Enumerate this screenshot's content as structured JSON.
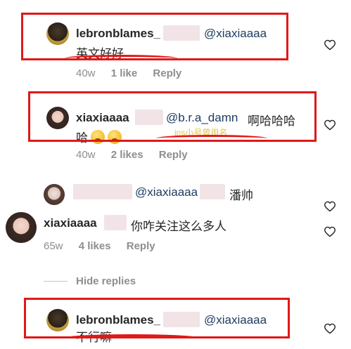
{
  "comments": [
    {
      "user": "lebronblames_",
      "mention": "@xiaxiaaaa",
      "text": "英文好好",
      "time": "40w",
      "likes": "1 like",
      "reply": "Reply"
    },
    {
      "user": "xiaxiaaaa",
      "mention": "@b.r.a_damn",
      "text_line1": "啊哈哈哈",
      "text_line2": "哈",
      "note": "ins小号曾用名",
      "time": "40w",
      "likes": "2 likes",
      "reply": "Reply"
    },
    {
      "mention": "@xiaxiaaaa",
      "text": "潘帅"
    },
    {
      "user": "xiaxiaaaa",
      "text": "你咋关注这么多人",
      "time": "65w",
      "likes": "4 likes",
      "reply": "Reply"
    },
    {
      "user": "lebronblames_",
      "mention": "@xiaxiaaaa",
      "text": "不行嘛"
    }
  ],
  "hide_replies": "Hide replies",
  "colors": {
    "highlight": "#e01818",
    "mention": "#1c3a5e",
    "meta": "#8e8e8e"
  },
  "icons": [
    "heart-icon",
    "emoji-icon"
  ]
}
